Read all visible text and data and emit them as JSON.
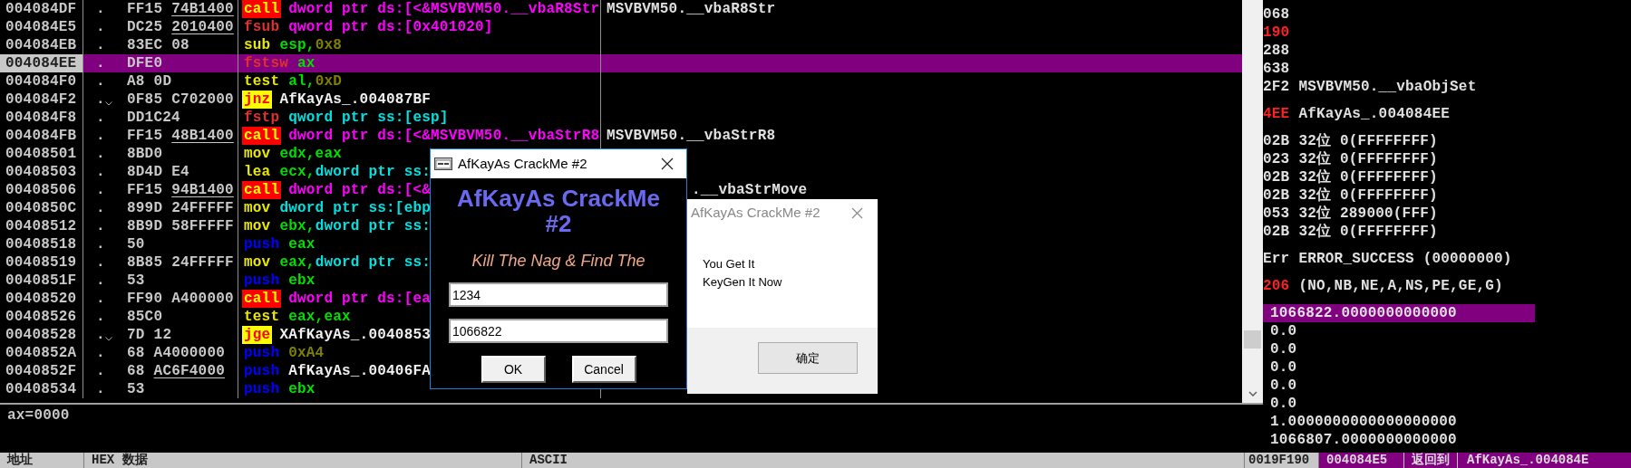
{
  "disassembly": {
    "rows": [
      {
        "address": "004084DF",
        "marker": ".",
        "jump": false,
        "selected": false,
        "opcode": "FF15",
        "operand_bytes": "74B1400",
        "underlined": true,
        "mnemonic": {
          "text": "call",
          "kind": "call"
        },
        "operands": [
          {
            "text": "dword ptr ds:[<&MSVBVM50.__vbaR8Str",
            "kind": "mem"
          }
        ],
        "comment": {
          "text": "MSVBVM50.__vbaR8Str",
          "covered": false
        }
      },
      {
        "address": "004084E5",
        "marker": ".",
        "jump": false,
        "selected": false,
        "opcode": "DC25",
        "operand_bytes": "2010400",
        "underlined": true,
        "mnemonic": {
          "text": "fsub",
          "kind": "fpu"
        },
        "operands": [
          {
            "text": "qword ptr ds:[0x401020]",
            "kind": "mem"
          }
        ]
      },
      {
        "address": "004084EB",
        "marker": ".",
        "jump": false,
        "selected": false,
        "opcode": "83EC",
        "operand_bytes": "08",
        "underlined": false,
        "mnemonic": {
          "text": "sub",
          "kind": "cmd"
        },
        "operands": [
          {
            "text": "esp,",
            "kind": "reg"
          },
          {
            "text": "0x8",
            "kind": "imm"
          }
        ]
      },
      {
        "address": "004084EE",
        "marker": ".",
        "jump": false,
        "selected": true,
        "opcode": "DFE0",
        "mnemonic": {
          "text": "fstsw",
          "kind": "fpu"
        },
        "operands": [
          {
            "text": "ax",
            "kind": "reg"
          }
        ]
      },
      {
        "address": "004084F0",
        "marker": ".",
        "jump": false,
        "selected": false,
        "opcode": "A8",
        "operand_bytes": "0D",
        "underlined": false,
        "mnemonic": {
          "text": "test",
          "kind": "cmd"
        },
        "operands": [
          {
            "text": "al,",
            "kind": "reg"
          },
          {
            "text": "0xD",
            "kind": "imm"
          }
        ]
      },
      {
        "address": "004084F2",
        "marker": ".",
        "jump": true,
        "selected": false,
        "opcode": "0F85",
        "operand_bytes": "C702000",
        "underlined": false,
        "mnemonic": {
          "text": "jnz",
          "kind": "jcc"
        },
        "operands": [
          {
            "text": "AfKayAs_.004087BF",
            "kind": "label"
          }
        ]
      },
      {
        "address": "004084F8",
        "marker": ".",
        "jump": false,
        "selected": false,
        "opcode": "DD1C24",
        "mnemonic": {
          "text": "fstp",
          "kind": "fpu"
        },
        "operands": [
          {
            "text": "qword ptr ss:[esp]",
            "kind": "stack"
          }
        ]
      },
      {
        "address": "004084FB",
        "marker": ".",
        "jump": false,
        "selected": false,
        "opcode": "FF15",
        "operand_bytes": "48B1400",
        "underlined": true,
        "mnemonic": {
          "text": "call",
          "kind": "call"
        },
        "operands": [
          {
            "text": "dword ptr ds:[<&MSVBVM50.__vbaStrR8",
            "kind": "mem"
          }
        ],
        "comment": {
          "text": "MSVBVM50.__vbaStrR8",
          "covered": false
        }
      },
      {
        "address": "00408501",
        "marker": ".",
        "jump": false,
        "selected": false,
        "opcode": "8BD0",
        "mnemonic": {
          "text": "mov",
          "kind": "cmd"
        },
        "operands": [
          {
            "text": "edx,eax",
            "kind": "reg"
          }
        ]
      },
      {
        "address": "00408503",
        "marker": ".",
        "jump": false,
        "selected": false,
        "opcode": "8D4D",
        "operand_bytes": "E4",
        "underlined": false,
        "mnemonic": {
          "text": "lea",
          "kind": "cmd"
        },
        "operands": [
          {
            "text": "ecx,",
            "kind": "reg"
          },
          {
            "text": "dword ptr ss:",
            "kind": "stack"
          }
        ]
      },
      {
        "address": "00408506",
        "marker": ".",
        "jump": false,
        "selected": false,
        "opcode": "FF15",
        "operand_bytes": "94B1400",
        "underlined": true,
        "mnemonic": {
          "text": "call",
          "kind": "call"
        },
        "operands": [
          {
            "text": "dword ptr ds:[<&",
            "kind": "mem"
          }
        ],
        "comment": {
          "text": ".__vbaStrMove",
          "covered": true
        }
      },
      {
        "address": "0040850C",
        "marker": ".",
        "jump": false,
        "selected": false,
        "opcode": "899D",
        "operand_bytes": "24FFFFF",
        "underlined": false,
        "mnemonic": {
          "text": "mov",
          "kind": "cmd"
        },
        "operands": [
          {
            "text": "dword ptr ss:[ebp",
            "kind": "stack"
          }
        ]
      },
      {
        "address": "00408512",
        "marker": ".",
        "jump": false,
        "selected": false,
        "opcode": "8B9D",
        "operand_bytes": "58FFFFF",
        "underlined": false,
        "mnemonic": {
          "text": "mov",
          "kind": "cmd"
        },
        "operands": [
          {
            "text": "ebx,",
            "kind": "reg"
          },
          {
            "text": "dword ptr ss:",
            "kind": "stack"
          }
        ]
      },
      {
        "address": "00408518",
        "marker": ".",
        "jump": false,
        "selected": false,
        "opcode": "50",
        "mnemonic": {
          "text": "push",
          "kind": "push"
        },
        "operands": [
          {
            "text": "eax",
            "kind": "reg"
          }
        ]
      },
      {
        "address": "00408519",
        "marker": ".",
        "jump": false,
        "selected": false,
        "opcode": "8B85",
        "operand_bytes": "24FFFFF",
        "underlined": false,
        "mnemonic": {
          "text": "mov",
          "kind": "cmd"
        },
        "operands": [
          {
            "text": "eax,",
            "kind": "reg"
          },
          {
            "text": "dword ptr ss:",
            "kind": "stack"
          }
        ]
      },
      {
        "address": "0040851F",
        "marker": ".",
        "jump": false,
        "selected": false,
        "opcode": "53",
        "mnemonic": {
          "text": "push",
          "kind": "push"
        },
        "operands": [
          {
            "text": "ebx",
            "kind": "reg"
          }
        ]
      },
      {
        "address": "00408520",
        "marker": ".",
        "jump": false,
        "selected": false,
        "opcode": "FF90",
        "operand_bytes": "A400000",
        "underlined": false,
        "mnemonic": {
          "text": "call",
          "kind": "call"
        },
        "operands": [
          {
            "text": "dword ptr ds:[ea",
            "kind": "mem"
          }
        ]
      },
      {
        "address": "00408526",
        "marker": ".",
        "jump": false,
        "selected": false,
        "opcode": "85C0",
        "mnemonic": {
          "text": "test",
          "kind": "cmd"
        },
        "operands": [
          {
            "text": "eax,eax",
            "kind": "reg"
          }
        ]
      },
      {
        "address": "00408528",
        "marker": ".",
        "jump": true,
        "selected": false,
        "opcode": "7D",
        "operand_bytes": "12",
        "underlined": false,
        "mnemonic": {
          "text": "jge",
          "kind": "jcc"
        },
        "operands": [
          {
            "text": "XAfKayAs_.0040853",
            "kind": "label"
          }
        ]
      },
      {
        "address": "0040852A",
        "marker": ".",
        "jump": false,
        "selected": false,
        "opcode": "68",
        "operand_bytes": "A4000000",
        "underlined": false,
        "mnemonic": {
          "text": "push",
          "kind": "push"
        },
        "operands": [
          {
            "text": "0xA4",
            "kind": "imm"
          }
        ]
      },
      {
        "address": "0040852F",
        "marker": ".",
        "jump": false,
        "selected": false,
        "opcode": "68",
        "operand_bytes": "AC6F4000",
        "underlined": true,
        "mnemonic": {
          "text": "push",
          "kind": "push"
        },
        "operands": [
          {
            "text": "AfKayAs_.00406FA",
            "kind": "label"
          }
        ]
      },
      {
        "address": "00408534",
        "marker": ".",
        "jump": false,
        "selected": false,
        "opcode": "53",
        "mnemonic": {
          "text": "push",
          "kind": "push"
        },
        "operands": [
          {
            "text": "ebx",
            "kind": "reg"
          }
        ]
      }
    ]
  },
  "info_pane": {
    "text": "ax=0000"
  },
  "registers": {
    "groups": [
      [
        {
          "value": "068",
          "changed": false
        },
        {
          "value": "190",
          "changed": true
        },
        {
          "value": "288",
          "changed": false
        },
        {
          "value": "638",
          "changed": false
        },
        {
          "value": "2F2",
          "changed": false,
          "detail": "MSVBVM50.__vbaObjSet"
        }
      ],
      [
        {
          "value": "4EE",
          "changed": true,
          "detail": "AfKayAs_.004084EE"
        }
      ],
      [
        {
          "value": "02B",
          "changed": false,
          "detail": "32位 0(FFFFFFFF)"
        },
        {
          "value": "023",
          "changed": false,
          "detail": "32位 0(FFFFFFFF)"
        },
        {
          "value": "02B",
          "changed": false,
          "detail": "32位 0(FFFFFFFF)"
        },
        {
          "value": "02B",
          "changed": false,
          "detail": "32位 0(FFFFFFFF)"
        },
        {
          "value": "053",
          "changed": false,
          "detail": "32位 289000(FFF)"
        },
        {
          "value": "02B",
          "changed": false,
          "detail": "32位 0(FFFFFFFF)"
        }
      ],
      [
        {
          "value": "Err",
          "changed": false,
          "detail": "ERROR_SUCCESS (00000000)"
        }
      ],
      [
        {
          "value": "206",
          "changed": true,
          "detail": "(NO,NB,NE,A,NS,PE,GE,G)"
        }
      ]
    ],
    "fpu": [
      {
        "text": "1066822.0000000000000",
        "selected": true
      },
      {
        "text": "0.0",
        "selected": false
      },
      {
        "text": "0.0",
        "selected": false
      },
      {
        "text": "0.0",
        "selected": false
      },
      {
        "text": "0.0",
        "selected": false
      },
      {
        "text": "0.0",
        "selected": false
      },
      {
        "text": "1.0000000000000000000",
        "selected": false
      },
      {
        "text": "1066807.0000000000000",
        "selected": false
      }
    ]
  },
  "dump_header": {
    "columns": [
      "地址",
      "HEX 数据",
      "ASCII"
    ]
  },
  "stack_row": {
    "address": "0019F190",
    "value": "004084E5",
    "label": "返回到",
    "comment": "AfKayAs_.004084E"
  },
  "crackme_dialog": {
    "title": "AfKayAs CrackMe #2",
    "heading": "AfKayAs CrackMe #2",
    "subtitle": "Kill The Nag & Find The",
    "fields": [
      "1234",
      "1066822"
    ],
    "buttons": [
      "OK",
      "Cancel"
    ]
  },
  "message_box": {
    "title": "AfKayAs CrackMe #2",
    "lines": [
      "You Get It",
      "KeyGen It Now"
    ],
    "button": "确定"
  }
}
